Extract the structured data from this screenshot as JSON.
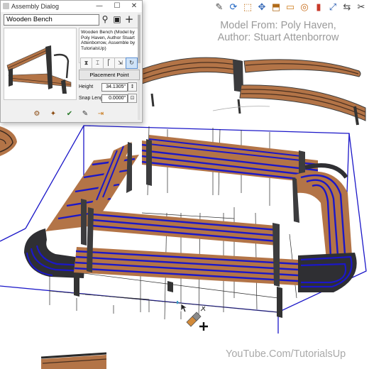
{
  "viewport": {
    "credit_line1": "Model From: Poly Haven,",
    "credit_line2": "Author: Stuart Attenborrow",
    "watermark": "YouTube.Com/TutorialsUp",
    "colors": {
      "wood": "#b37447",
      "selection_blue": "#1b17c8",
      "bounding_lines": "#2a2a2a",
      "background": "#ffffff"
    }
  },
  "toolbar": {
    "icons": [
      "pencil-icon",
      "rotate-icon",
      "paint-icon",
      "move-icon",
      "select-icon",
      "box-icon",
      "hide-icon",
      "eraser-icon",
      "scale-icon",
      "tape-icon",
      "scissors-icon",
      "component-icon"
    ],
    "glyphs": [
      "✎",
      "⟳",
      "⬚",
      "✥",
      "⬒",
      "▭",
      "◎",
      "▮",
      "⤢",
      "⇆",
      "✂",
      "⬡"
    ]
  },
  "dialog": {
    "title": "Assembly Dialog",
    "window_buttons": {
      "minimize": "—",
      "maximize": "☐",
      "close": "✕"
    },
    "search_value": "Wooden Bench",
    "search_icons": {
      "search": "⚲",
      "save": "▣",
      "add": "+"
    },
    "description": "Wooden Bench (Model by Poly Haven, Author Stuart Attenborrow, Assemble by TutorialsUp)",
    "insert_buttons": [
      "⧗",
      "⌶",
      "⎡",
      "⇲",
      "↻"
    ],
    "placement_point_label": "Placement Point",
    "height_label": "Height",
    "height_value": "34.1305\"",
    "snap_label": "Snap Length",
    "snap_value": "0.0000\"",
    "bottom_tools": [
      "⚙",
      "✦",
      "✔",
      "✎",
      "⇥"
    ]
  }
}
